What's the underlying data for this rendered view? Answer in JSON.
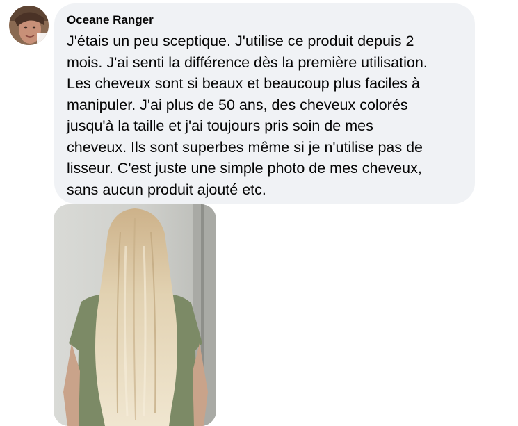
{
  "comment": {
    "author": "Oceane Ranger",
    "text": "J'étais un peu sceptique. J'utilise ce produit depuis 2\nmois. J'ai senti la différence dès la première utilisation.\nLes cheveux sont si beaux et beaucoup plus faciles à\nmanipuler. J'ai plus de 50 ans, des cheveux colorés\njusqu'à la taille et j'ai toujours pris soin de mes\ncheveux. Ils sont superbes même si je n'utilise pas de\nlisseur. C'est juste une simple photo de mes cheveux,\nsans aucun produit ajouté etc.",
    "avatar_icon": "profile-photo",
    "attachment_icon": "photo-long-blonde-hair-back-view"
  },
  "colors": {
    "bubble_background": "#f0f2f5",
    "text": "#050505"
  }
}
